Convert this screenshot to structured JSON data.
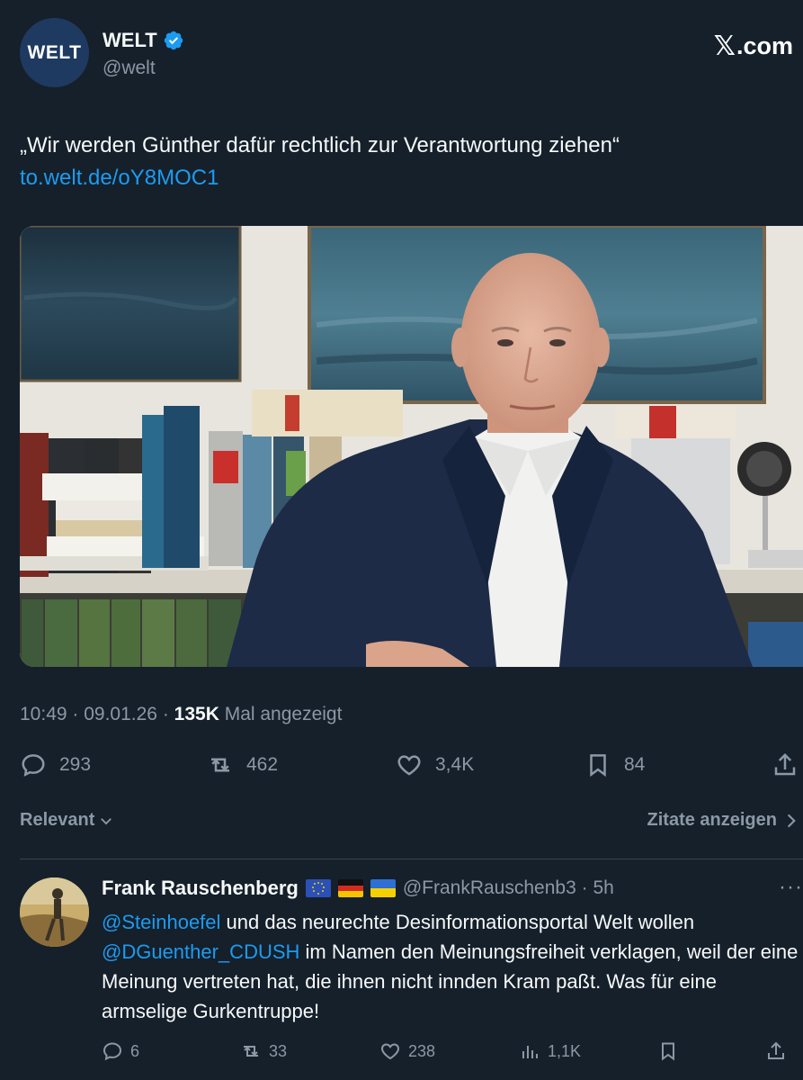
{
  "author": {
    "avatar_text": "WELT",
    "display_name": "WELT",
    "handle": "@welt",
    "verified": true
  },
  "brand": {
    "logo_text": ".com"
  },
  "tweet": {
    "text": "„Wir werden Günther dafür rechtlich zur Verantwortung ziehen“",
    "link": "to.welt.de/oY8MOC1",
    "time": "10:49",
    "date": "09.01.26",
    "views_count": "135K",
    "views_label": "Mal angezeigt"
  },
  "actions": {
    "replies": "293",
    "reposts": "462",
    "likes": "3,4K",
    "bookmarks": "84"
  },
  "filter": {
    "sort_label": "Relevant",
    "quotes_label": "Zitate anzeigen"
  },
  "reply": {
    "display_name": "Frank Rauschenberg",
    "flags": [
      "eu-flag-icon",
      "germany-flag-icon",
      "ukraine-flag-icon"
    ],
    "handle": "@FrankRauschenb3",
    "separator": "·",
    "time": "5h",
    "mention_1": "@Steinhoefel",
    "text_1": " und das neurechte Desinformationsportal Welt wollen",
    "mention_2": "@DGuenther_CDUSH",
    "text_2": " im Namen den Meinungsfreiheit verklagen, weil der eine Meinung vertreten hat, die ihnen nicht innden Kram paßt. Was für eine armselige Gurkentruppe!",
    "replies": "6",
    "reposts": "33",
    "likes": "238",
    "views": "1,1K"
  },
  "colors": {
    "background": "#15202b",
    "accent": "#1d9bf0",
    "muted": "#8b98a5",
    "divider": "#38444d"
  }
}
